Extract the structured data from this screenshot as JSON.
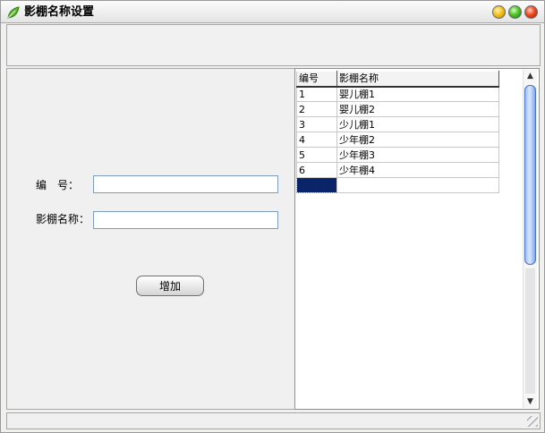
{
  "window": {
    "title": "影棚名称设置",
    "icon": "leaf-app-icon"
  },
  "form": {
    "id_label": "编　号：",
    "name_label": "影棚名称：",
    "id_value": "",
    "name_value": "",
    "add_label": "增加"
  },
  "grid": {
    "columns": [
      "编号",
      "影棚名称"
    ],
    "rows": [
      [
        "1",
        "婴儿棚1"
      ],
      [
        "2",
        "婴儿棚2"
      ],
      [
        "3",
        "少儿棚1"
      ],
      [
        "4",
        "少年棚2"
      ],
      [
        "5",
        "少年棚3"
      ],
      [
        "6",
        "少年棚4"
      ]
    ]
  },
  "colors": {
    "selection": "#0a246a",
    "scroll_thumb": "#9fc0f5"
  }
}
